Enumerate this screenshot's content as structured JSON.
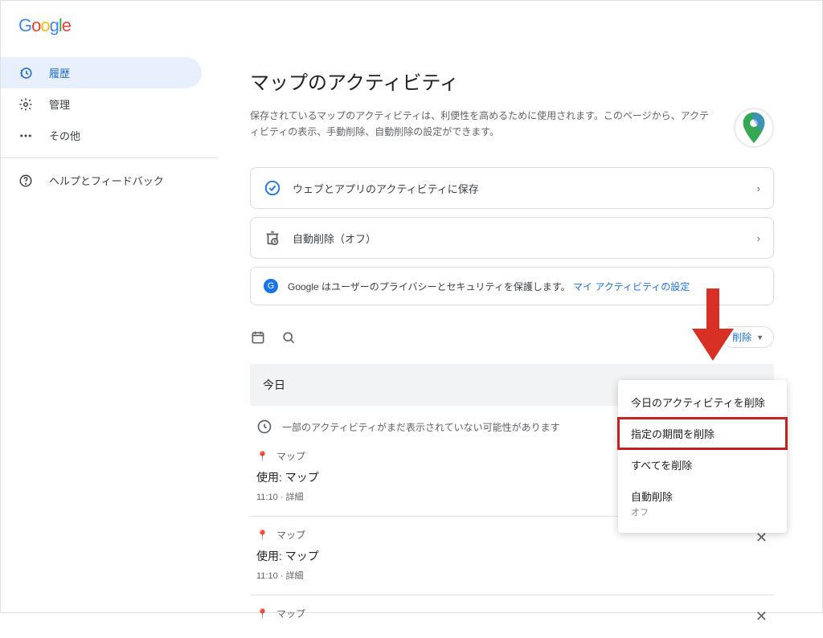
{
  "logo": {
    "text": "Google"
  },
  "sidebar": {
    "items": [
      {
        "label": "履歴",
        "icon": "history-icon"
      },
      {
        "label": "管理",
        "icon": "gear-icon"
      },
      {
        "label": "その他",
        "icon": "more-icon"
      }
    ],
    "help": {
      "label": "ヘルプとフィードバック"
    }
  },
  "page": {
    "title": "マップのアクティビティ",
    "description": "保存されているマップのアクティビティは、利便性を高めるために使用されます。このページから、アクティビティの表示、手動削除、自動削除の設定ができます。"
  },
  "cards": {
    "save_to": "ウェブとアプリのアクティビティに保存",
    "auto_delete": "自動削除（オフ）",
    "privacy_text": "Google はユーザーのプライバシーとセキュリティを保護します。",
    "privacy_link": "マイ アクティビティの設定"
  },
  "toolbar": {
    "delete_label": "削除"
  },
  "section": {
    "today": "今日"
  },
  "notice": "一部のアクティビティがまだ表示されていない可能性があります",
  "activity": {
    "app_name": "マップ",
    "title": "使用: マップ",
    "time": "11:10",
    "details": "詳細"
  },
  "menu": {
    "item1": "今日のアクティビティを削除",
    "item2": "指定の期間を削除",
    "item3": "すべてを削除",
    "item4": "自動削除",
    "item4_sub": "オフ"
  }
}
